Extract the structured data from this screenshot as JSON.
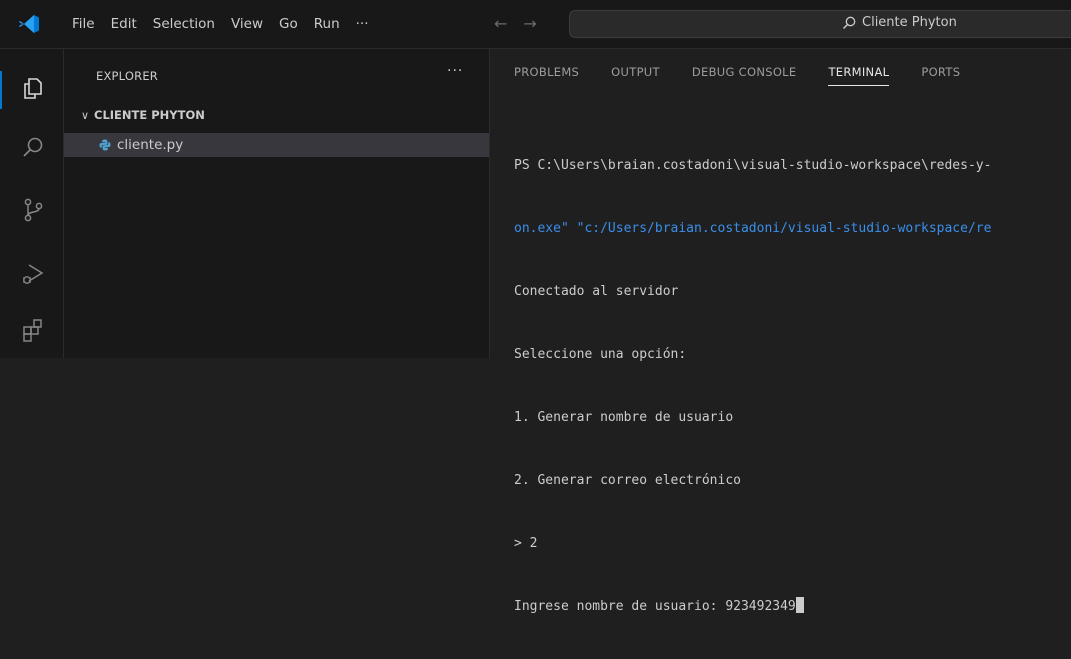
{
  "menu": {
    "items": [
      "File",
      "Edit",
      "Selection",
      "View",
      "Go",
      "Run",
      "···"
    ]
  },
  "search": {
    "text": "Cliente Phyton"
  },
  "icons": {
    "app": "vscode-logo-icon",
    "explorer": "files-icon",
    "search": "search-icon",
    "source_control": "source-control-icon",
    "run_debug": "run-debug-icon",
    "extensions": "extensions-icon"
  },
  "colors": {
    "accent": "#0078d4",
    "link_blue": "#3b8eea",
    "python_icon": "#4f9fcf"
  },
  "sidebar": {
    "header": "EXPLORER",
    "more": "···",
    "folder": "CLIENTE PHYTON",
    "files": [
      "cliente.py"
    ]
  },
  "panel": {
    "tabs": [
      "PROBLEMS",
      "OUTPUT",
      "DEBUG CONSOLE",
      "TERMINAL",
      "PORTS"
    ],
    "active_tab": "TERMINAL",
    "terminal_lines": [
      "PS C:\\Users\\braian.costadoni\\visual-studio-workspace\\redes-y-",
      "on.exe\" \"c:/Users/braian.costadoni/visual-studio-workspace/re",
      "Conectado al servidor",
      "Seleccione una opción:",
      "1. Generar nombre de usuario",
      "2. Generar correo electrónico",
      "> 2",
      "Ingrese nombre de usuario: 923492349"
    ]
  }
}
